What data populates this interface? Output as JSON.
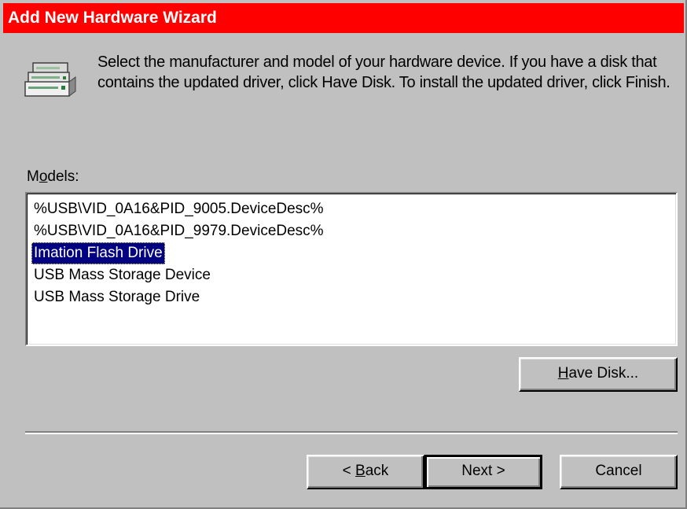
{
  "window": {
    "title": "Add New Hardware Wizard"
  },
  "instructions": {
    "text": "Select the manufacturer and model of your hardware device. If you have a disk that contains the updated driver, click Have Disk. To install the updated driver, click Finish."
  },
  "models": {
    "label_prefix": "M",
    "label_accel": "o",
    "label_suffix": "dels:",
    "items": [
      "%USB\\VID_0A16&PID_9005.DeviceDesc%",
      "%USB\\VID_0A16&PID_9979.DeviceDesc%",
      "Imation Flash Drive",
      "USB Mass Storage Device",
      "USB Mass Storage Drive"
    ],
    "selected_index": 2
  },
  "buttons": {
    "have_disk_accel": "H",
    "have_disk_rest": "ave Disk...",
    "back_prefix": "< ",
    "back_accel": "B",
    "back_rest": "ack",
    "next": "Next >",
    "cancel": "Cancel"
  },
  "colors": {
    "titlebar": "#ff0000",
    "face": "#c0c0c0",
    "selection": "#000080"
  },
  "icons": {
    "hardware": "hardware-device-icon"
  }
}
